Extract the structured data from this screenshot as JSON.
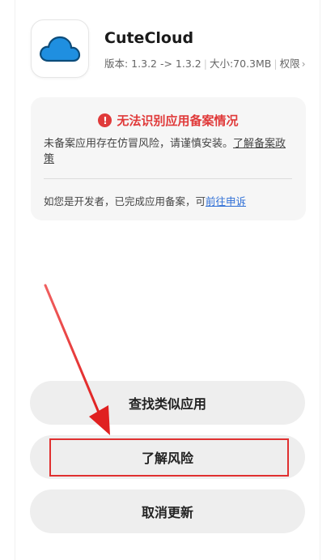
{
  "app": {
    "name": "CuteCloud",
    "version_label": "版本: 1.3.2 -> 1.3.2",
    "size_label": "大小:70.3MB",
    "permission_label": "权限",
    "icon": "cloud-icon",
    "icon_color": "#1f8fe0"
  },
  "warning": {
    "title": "无法识别应用备案情况",
    "icon_glyph": "!",
    "body": "未备案应用存在仿冒风险，请谨慎安装。",
    "link_text": "了解备案政策",
    "developer_text": "如您是开发者，已完成应用备案，可",
    "appeal_link": "前往申诉"
  },
  "buttons": {
    "find_similar": "查找类似应用",
    "learn_risk": "了解风险",
    "cancel_update": "取消更新"
  },
  "colors": {
    "warning_red": "#e03a3a",
    "link_blue": "#2f6fd6",
    "annotation_red": "#e03030"
  }
}
